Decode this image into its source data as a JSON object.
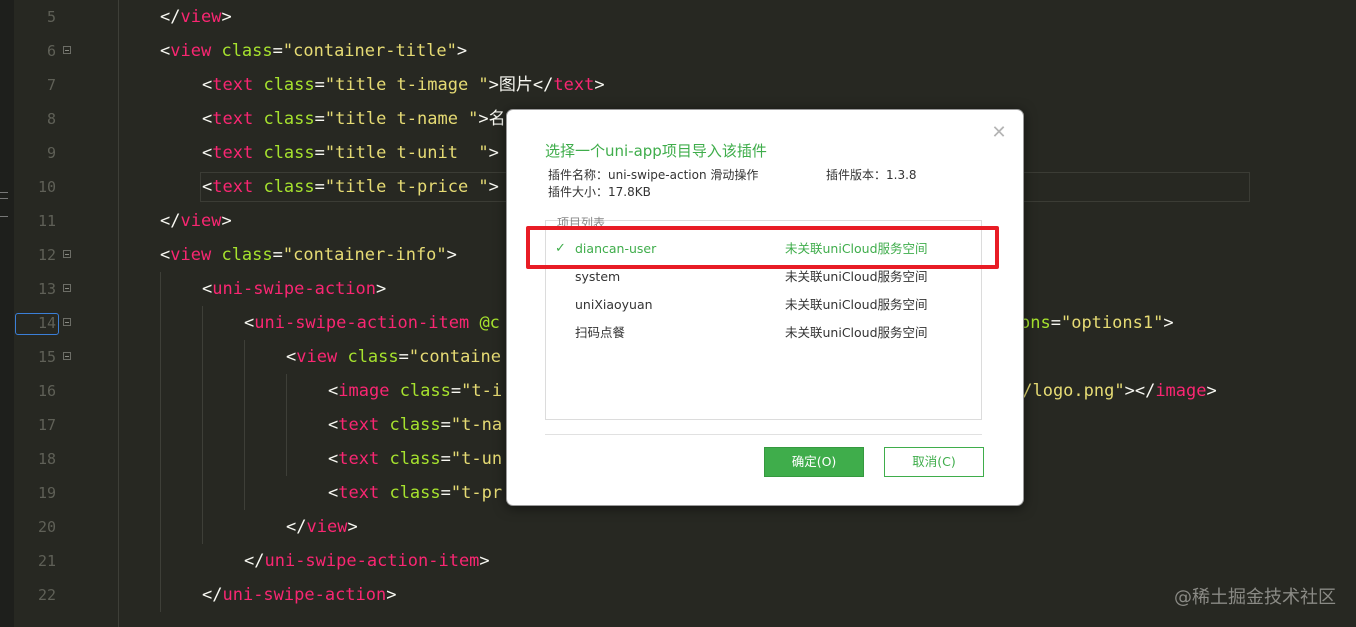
{
  "editor": {
    "lines": [
      {
        "num": "5",
        "fold": false,
        "segments": [
          [
            "p",
            "</"
          ],
          [
            "t",
            "view"
          ],
          [
            "p",
            ">"
          ]
        ]
      },
      {
        "num": "6",
        "fold": true,
        "segments": [
          [
            "p",
            "<"
          ],
          [
            "t",
            "view"
          ],
          [
            "p",
            " "
          ],
          [
            "a",
            "class"
          ],
          [
            "p",
            "="
          ],
          [
            "s",
            "\"container-title\""
          ],
          [
            "p",
            ">"
          ]
        ]
      },
      {
        "num": "7",
        "fold": false,
        "segments": [
          [
            "p",
            "<"
          ],
          [
            "t",
            "text"
          ],
          [
            "p",
            " "
          ],
          [
            "a",
            "class"
          ],
          [
            "p",
            "="
          ],
          [
            "s",
            "\"title t-image \""
          ],
          [
            "p",
            ">图片</"
          ],
          [
            "t",
            "text"
          ],
          [
            "p",
            ">"
          ]
        ]
      },
      {
        "num": "8",
        "fold": false,
        "segments": [
          [
            "p",
            "<"
          ],
          [
            "t",
            "text"
          ],
          [
            "p",
            " "
          ],
          [
            "a",
            "class"
          ],
          [
            "p",
            "="
          ],
          [
            "s",
            "\"title t-name \""
          ],
          [
            "p",
            ">名"
          ]
        ]
      },
      {
        "num": "9",
        "fold": false,
        "segments": [
          [
            "p",
            "<"
          ],
          [
            "t",
            "text"
          ],
          [
            "p",
            " "
          ],
          [
            "a",
            "class"
          ],
          [
            "p",
            "="
          ],
          [
            "s",
            "\"title t-unit  \""
          ],
          [
            "p",
            ">"
          ]
        ]
      },
      {
        "num": "10",
        "fold": false,
        "segments": [
          [
            "p",
            "<"
          ],
          [
            "t",
            "text"
          ],
          [
            "p",
            " "
          ],
          [
            "a",
            "class"
          ],
          [
            "p",
            "="
          ],
          [
            "s",
            "\"title t-price \""
          ],
          [
            "p",
            ">"
          ]
        ]
      },
      {
        "num": "11",
        "fold": false,
        "segments": [
          [
            "p",
            "</"
          ],
          [
            "t",
            "view"
          ],
          [
            "p",
            ">"
          ]
        ]
      },
      {
        "num": "12",
        "fold": true,
        "segments": [
          [
            "p",
            "<"
          ],
          [
            "t",
            "view"
          ],
          [
            "p",
            " "
          ],
          [
            "a",
            "class"
          ],
          [
            "p",
            "="
          ],
          [
            "s",
            "\"container-info\""
          ],
          [
            "p",
            ">"
          ]
        ]
      },
      {
        "num": "13",
        "fold": true,
        "segments": [
          [
            "p",
            "<"
          ],
          [
            "t",
            "uni-swipe-action"
          ],
          [
            "p",
            ">"
          ]
        ]
      },
      {
        "num": "14",
        "fold": true,
        "segments": [
          [
            "p",
            "<"
          ],
          [
            "t",
            "uni-swipe-action-item"
          ],
          [
            "p",
            " "
          ],
          [
            "a",
            "@c"
          ]
        ],
        "tail": [
          [
            "a",
            "ons"
          ],
          [
            "p",
            "="
          ],
          [
            "s",
            "\"options1\""
          ],
          [
            "p",
            ">"
          ]
        ]
      },
      {
        "num": "15",
        "fold": true,
        "segments": [
          [
            "p",
            "<"
          ],
          [
            "t",
            "view"
          ],
          [
            "p",
            " "
          ],
          [
            "a",
            "class"
          ],
          [
            "p",
            "="
          ],
          [
            "s",
            "\"containe"
          ]
        ]
      },
      {
        "num": "16",
        "fold": false,
        "segments": [
          [
            "p",
            "<"
          ],
          [
            "t",
            "image"
          ],
          [
            "p",
            " "
          ],
          [
            "a",
            "class"
          ],
          [
            "p",
            "="
          ],
          [
            "s",
            "\"t-i"
          ]
        ],
        "tail": [
          [
            "s",
            "c/logo.png\""
          ],
          [
            "p",
            "></"
          ],
          [
            "t",
            "image"
          ],
          [
            "p",
            ">"
          ]
        ]
      },
      {
        "num": "17",
        "fold": false,
        "segments": [
          [
            "p",
            "<"
          ],
          [
            "t",
            "text"
          ],
          [
            "p",
            " "
          ],
          [
            "a",
            "class"
          ],
          [
            "p",
            "="
          ],
          [
            "s",
            "\"t-na"
          ]
        ]
      },
      {
        "num": "18",
        "fold": false,
        "segments": [
          [
            "p",
            "<"
          ],
          [
            "t",
            "text"
          ],
          [
            "p",
            " "
          ],
          [
            "a",
            "class"
          ],
          [
            "p",
            "="
          ],
          [
            "s",
            "\"t-un"
          ]
        ]
      },
      {
        "num": "19",
        "fold": false,
        "segments": [
          [
            "p",
            "<"
          ],
          [
            "t",
            "text"
          ],
          [
            "p",
            " "
          ],
          [
            "a",
            "class"
          ],
          [
            "p",
            "="
          ],
          [
            "s",
            "\"t-pr"
          ]
        ]
      },
      {
        "num": "20",
        "fold": false,
        "segments": [
          [
            "p",
            "</"
          ],
          [
            "t",
            "view"
          ],
          [
            "p",
            ">"
          ]
        ]
      },
      {
        "num": "21",
        "fold": false,
        "segments": [
          [
            "p",
            "</"
          ],
          [
            "t",
            "uni-swipe-action-item"
          ],
          [
            "p",
            ">"
          ]
        ]
      },
      {
        "num": "22",
        "fold": false,
        "segments": [
          [
            "p",
            "</"
          ],
          [
            "t",
            "uni-swipe-action"
          ],
          [
            "p",
            ">"
          ]
        ]
      }
    ]
  },
  "dialog": {
    "title": "选择一个uni-app项目导入该插件",
    "plugin_name_label": "插件名称：",
    "plugin_name": "uni-swipe-action 滑动操作",
    "plugin_version_label": "插件版本：",
    "plugin_version": "1.3.8",
    "plugin_size_label": "插件大小：",
    "plugin_size": "17.8KB",
    "list_label": "项目列表",
    "projects": [
      {
        "name": "diancan-user",
        "status": "未关联uniCloud服务空间",
        "selected": true
      },
      {
        "name": "system",
        "status": "未关联uniCloud服务空间",
        "selected": false
      },
      {
        "name": "uniXiaoyuan",
        "status": "未关联uniCloud服务空间",
        "selected": false
      },
      {
        "name": "扫码点餐",
        "status": "未关联uniCloud服务空间",
        "selected": false
      }
    ],
    "ok_label": "确定(O)",
    "cancel_label": "取消(C)",
    "close_glyph": "✕",
    "check_glyph": "✓"
  },
  "watermark": "@稀土掘金技术社区",
  "colors": {
    "editor_bg": "#272822",
    "tag": "#f92672",
    "attr": "#a6e22e",
    "string": "#e6db74",
    "accent_green": "#3fad4b",
    "highlight_red": "#e81c25"
  }
}
